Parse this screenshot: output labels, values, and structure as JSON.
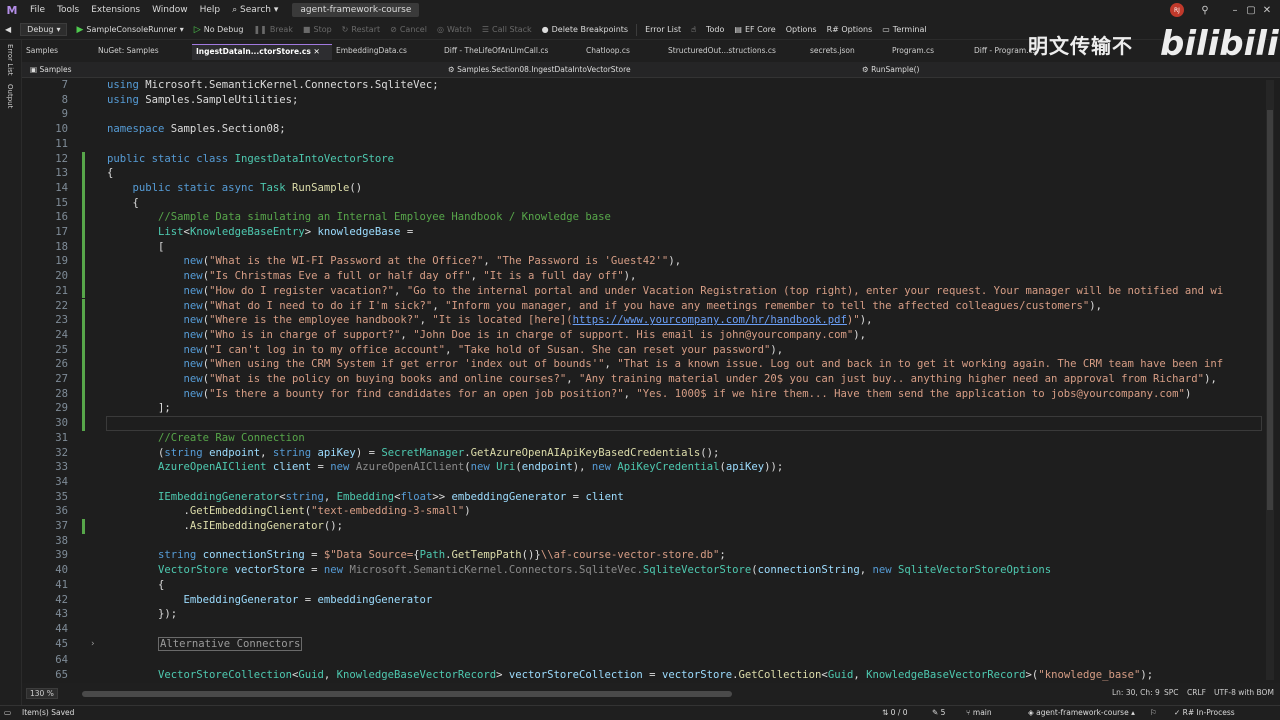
{
  "menubar": {
    "logo": "M",
    "items": [
      "File",
      "Tools",
      "Extensions",
      "Window",
      "Help"
    ],
    "search": "Search",
    "solution": "agent-framework-course",
    "avatar": "RJ"
  },
  "toolbar": {
    "config": "Debug",
    "run_target": "SampleConsoleRunner",
    "no_debug": "No Debug",
    "break": "Break",
    "stop": "Stop",
    "restart": "Restart",
    "cancel": "Cancel",
    "watch": "Watch",
    "call_stack": "Call Stack",
    "delete_breakpoints": "Delete Breakpoints",
    "error_list": "Error List",
    "todo": "Todo",
    "ef_core": "EF Core",
    "options": "Options",
    "rsharp_options": "R# Options",
    "terminal": "Terminal"
  },
  "side": {
    "error_list": "Error List",
    "output": "Output"
  },
  "tabs": [
    {
      "label": "Samples",
      "active": false
    },
    {
      "label": "NuGet: Samples",
      "active": false
    },
    {
      "label": "IngestDataIn...ctorStore.cs",
      "active": true
    },
    {
      "label": "EmbeddingData.cs",
      "active": false
    },
    {
      "label": "Diff - TheLifeOfAnLlmCall.cs",
      "active": false
    },
    {
      "label": "Chatloop.cs",
      "active": false
    },
    {
      "label": "StructuredOut...structions.cs",
      "active": false
    },
    {
      "label": "secrets.json",
      "active": false
    },
    {
      "label": "Program.cs",
      "active": false
    },
    {
      "label": "Diff - Program.cs",
      "active": false
    }
  ],
  "navbar": {
    "project": "Samples",
    "type": "Samples.Section08.IngestDataIntoVectorStore",
    "member": "RunSample()"
  },
  "code_lines": [
    {
      "n": "7",
      "html": "<span class='kw'>using</span> Microsoft.SemanticKernel.Connectors.SqliteVec;"
    },
    {
      "n": "8",
      "html": "<span class='kw'>using</span> Samples.SampleUtilities;"
    },
    {
      "n": "9",
      "html": ""
    },
    {
      "n": "10",
      "html": "<span class='kw'>namespace</span> Samples.Section08;"
    },
    {
      "n": "11",
      "html": ""
    },
    {
      "n": "12",
      "html": "<span class='kw'>public static class</span> <span class='ty'>IngestDataIntoVectorStore</span>"
    },
    {
      "n": "13",
      "html": "{"
    },
    {
      "n": "14",
      "html": "    <span class='kw'>public static async</span> <span class='ty'>Task</span> <span class='mt'>RunSample</span>()"
    },
    {
      "n": "15",
      "html": "    {"
    },
    {
      "n": "16",
      "html": "        <span class='cm'>//Sample Data simulating an Internal Employee Handbook / Knowledge base</span>"
    },
    {
      "n": "17",
      "html": "        <span class='ty'>List</span>&lt;<span class='ty'>KnowledgeBaseEntry</span>&gt; <span class='pa'>knowledgeBase</span> ="
    },
    {
      "n": "18",
      "html": "        ["
    },
    {
      "n": "19",
      "html": "            <span class='kw'>new</span>(<span class='st'>\"What is the WI-FI Password at the Office?\"</span>, <span class='st'>\"The Password is 'Guest42'\"</span>),"
    },
    {
      "n": "20",
      "html": "            <span class='kw'>new</span>(<span class='st'>\"Is Christmas Eve a full or half day off\"</span>, <span class='st'>\"It is a full day off\"</span>),"
    },
    {
      "n": "21",
      "html": "            <span class='kw'>new</span>(<span class='st'>\"How do I register vacation?\"</span>, <span class='st'>\"Go to the internal portal and under Vacation Registration (top right), enter your request. Your manager will be notified and wi</span>"
    },
    {
      "n": "22",
      "html": "            <span class='kw'>new</span>(<span class='st'>\"What do I need to do if I'm sick?\"</span>, <span class='st'>\"Inform you manager, and if you have any meetings remember to tell the affected colleagues/customers\"</span>),"
    },
    {
      "n": "23",
      "html": "            <span class='kw'>new</span>(<span class='st'>\"Where is the employee handbook?\"</span>, <span class='st'>\"It is located [here](</span><span class='link'>https://www.yourcompany.com/hr/handbook.pdf</span><span class='st'>)\"</span>),"
    },
    {
      "n": "24",
      "html": "            <span class='kw'>new</span>(<span class='st'>\"Who is in charge of support?\"</span>, <span class='st'>\"John Doe is in charge of support. His email is john@yourcompany.com\"</span>),"
    },
    {
      "n": "25",
      "html": "            <span class='kw'>new</span>(<span class='st'>\"I can't log in to my office account\"</span>, <span class='st'>\"Take hold of Susan. She can reset your password\"</span>),"
    },
    {
      "n": "26",
      "html": "            <span class='kw'>new</span>(<span class='st'>\"When using the CRM System if get error 'index out of bounds'\"</span>, <span class='st'>\"That is a known issue. Log out and back in to get it working again. The CRM team have been inf</span>"
    },
    {
      "n": "27",
      "html": "            <span class='kw'>new</span>(<span class='st'>\"What is the policy on buying books and online courses?\"</span>, <span class='st'>\"Any training material under 20$ you can just buy.. anything higher need an approval from Richard\"</span>),"
    },
    {
      "n": "28",
      "html": "            <span class='kw'>new</span>(<span class='st'>\"Is there a bounty for find candidates for an open job position?\"</span>, <span class='st'>\"Yes. 1000$ if we hire them... Have them send the application to jobs@yourcompany.com\"</span>)"
    },
    {
      "n": "29",
      "html": "        ];"
    },
    {
      "n": "30",
      "html": ""
    },
    {
      "n": "31",
      "html": "        <span class='cm'>//Create Raw Connection</span>"
    },
    {
      "n": "32",
      "html": "        (<span class='kw'>string</span> <span class='pa'>endpoint</span>, <span class='kw'>string</span> <span class='pa'>apiKey</span>) = <span class='ty'>SecretManager</span>.<span class='mt'>GetAzureOpenAIApiKeyBasedCredentials</span>();"
    },
    {
      "n": "33",
      "html": "        <span class='ty'>AzureOpenAIClient</span> <span class='pa'>client</span> = <span class='kw'>new</span> <span class='grey'>AzureOpenAIClient</span>(<span class='kw'>new</span> <span class='ty'>Uri</span>(<span class='pa'>endpoint</span>), <span class='kw'>new</span> <span class='ty'>ApiKeyCredential</span>(<span class='pa'>apiKey</span>));"
    },
    {
      "n": "34",
      "html": ""
    },
    {
      "n": "35",
      "html": "        <span class='ty'>IEmbeddingGenerator</span>&lt;<span class='kw'>string</span>, <span class='ty'>Embedding</span>&lt;<span class='kw'>float</span>&gt;&gt; <span class='pa'>embeddingGenerator</span> = <span class='pa'>client</span>"
    },
    {
      "n": "36",
      "html": "            .<span class='mt'>GetEmbeddingClient</span>(<span class='st'>\"text-embedding-3-small\"</span>)"
    },
    {
      "n": "37",
      "html": "            .<span class='mt'>AsIEmbeddingGenerator</span>();"
    },
    {
      "n": "38",
      "html": ""
    },
    {
      "n": "39",
      "html": "        <span class='kw'>string</span> <span class='pa'>connectionString</span> = <span class='st'>$\"Data Source=</span>{<span class='ty'>Path</span>.<span class='mt'>GetTempPath</span>()}<span class='st'>\\\\af-course-vector-store.db\"</span>;"
    },
    {
      "n": "40",
      "html": "        <span class='ty'>VectorStore</span> <span class='pa'>vectorStore</span> = <span class='kw'>new</span> <span class='grey'>Microsoft.SemanticKernel.Connectors.SqliteVec.</span><span class='ty'>SqliteVectorStore</span>(<span class='pa'>connectionString</span>, <span class='kw'>new</span> <span class='ty'>SqliteVectorStoreOptions</span>"
    },
    {
      "n": "41",
      "html": "        {"
    },
    {
      "n": "42",
      "html": "            <span class='pa'>EmbeddingGenerator</span> = <span class='pa'>embeddingGenerator</span>"
    },
    {
      "n": "43",
      "html": "        });"
    },
    {
      "n": "44",
      "html": ""
    },
    {
      "n": "45",
      "html": "        <span class='collapsed'>Alternative Connectors</span>"
    },
    {
      "n": "64",
      "html": ""
    },
    {
      "n": "65",
      "html": "        <span class='ty'>VectorStoreCollection</span>&lt;<span class='ty'>Guid</span>, <span class='ty'>KnowledgeBaseVectorRecord</span>&gt; <span class='pa'>vectorStoreCollection</span> = <span class='pa'>vectorStore</span>.<span class='mt'>GetCollection</span>&lt;<span class='ty'>Guid</span>, <span class='ty'>KnowledgeBaseVectorRecord</span>&gt;(<span class='st'>\"knowledge_base\"</span>);"
    }
  ],
  "bottom": {
    "zoom": "130 %",
    "position": "Ln: 30, Ch: 9",
    "spc": "SPC",
    "crlf": "CRLF",
    "encoding": "UTF-8 with BOM"
  },
  "status": {
    "message": "Item(s) Saved",
    "changes": "0 / 0",
    "commits": "5",
    "branch": "main",
    "repo": "agent-framework-course",
    "rsharp": "R# In-Process"
  },
  "watermark": {
    "text": "明文传输不",
    "brand": "bilibili"
  }
}
